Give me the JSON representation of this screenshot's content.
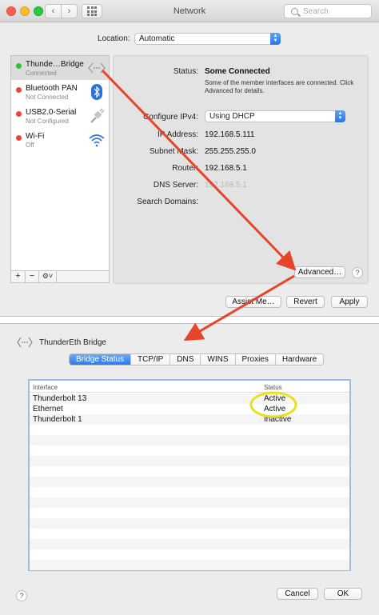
{
  "window": {
    "title": "Network",
    "search_placeholder": "Search"
  },
  "location": {
    "label": "Location:",
    "value": "Automatic"
  },
  "services": [
    {
      "name": "Thunde…Bridge",
      "status": "Connected",
      "dot_color": "#2bc43f",
      "icon": "bridge-icon"
    },
    {
      "name": "Bluetooth PAN",
      "status": "Not Connected",
      "dot_color": "#f0433a",
      "icon": "bluetooth-icon"
    },
    {
      "name": "USB2.0-Serial",
      "status": "Not Configured",
      "dot_color": "#f0433a",
      "icon": "usb-serial-icon"
    },
    {
      "name": "Wi-Fi",
      "status": "Off",
      "dot_color": "#f0433a",
      "icon": "wifi-icon"
    }
  ],
  "list_toolbar": {
    "add": "+",
    "remove": "−",
    "action": "⚙︎˅"
  },
  "detail": {
    "status_label": "Status:",
    "status_value": "Some Connected",
    "status_desc": "Some of the member interfaces are connected. Click Advanced for details.",
    "ipv4_label": "Configure IPv4:",
    "ipv4_value": "Using DHCP",
    "ip_label": "IP Address:",
    "ip_value": "192.168.5.111",
    "mask_label": "Subnet Mask:",
    "mask_value": "255.255.255.0",
    "router_label": "Router:",
    "router_value": "192.168.5.1",
    "dns_label": "DNS Server:",
    "dns_value": "192.168.5.1",
    "search_domains_label": "Search Domains:",
    "advanced_label": "Advanced…",
    "help": "?"
  },
  "footer_buttons": {
    "assist": "Assist Me…",
    "revert": "Revert",
    "apply": "Apply"
  },
  "bridge": {
    "title": "ThunderEth Bridge",
    "tabs": [
      "Bridge Status",
      "TCP/IP",
      "DNS",
      "WINS",
      "Proxies",
      "Hardware"
    ],
    "columns": {
      "interface": "Interface",
      "status": "Status"
    },
    "rows": [
      {
        "interface": "Thunderbolt 13",
        "status": "Active"
      },
      {
        "interface": "Ethernet",
        "status": "Active"
      },
      {
        "interface": "Thunderbolt 1",
        "status": "Inactive"
      }
    ],
    "help": "?",
    "cancel": "Cancel",
    "ok": "OK"
  },
  "colors": {
    "accent": "#2b7be6",
    "annotation_arrow": "#e8432b",
    "annotation_highlight": "#e8e21e"
  }
}
